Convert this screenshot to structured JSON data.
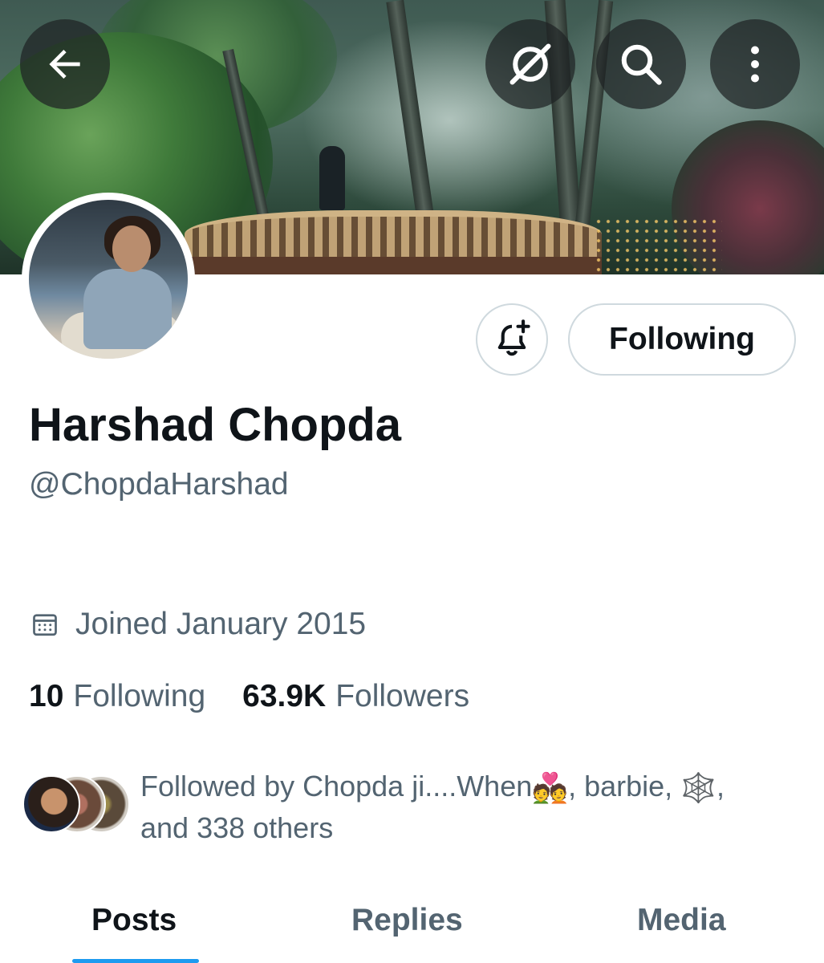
{
  "header": {
    "back_icon": "arrow-left-icon",
    "actions": [
      {
        "name": "grok-icon"
      },
      {
        "name": "search-icon"
      },
      {
        "name": "more-vertical-icon"
      }
    ]
  },
  "profile": {
    "display_name": "Harshad Chopda",
    "handle": "@ChopdaHarshad",
    "joined": "Joined January 2015",
    "joined_icon": "calendar-icon",
    "follow_button_label": "Following",
    "notify_icon": "bell-plus-icon"
  },
  "stats": {
    "following_count": "10",
    "following_label": "Following",
    "followers_count": "63.9K",
    "followers_label": "Followers"
  },
  "followed_by": {
    "prefix": "Followed by Chopda ji....When",
    "emoji_couple": "💑",
    "middle": ", barbie, ",
    "emoji_web": "🕸️",
    "suffix": ",",
    "line2": "and 338 others"
  },
  "tabs": [
    {
      "label": "Posts",
      "active": true
    },
    {
      "label": "Replies",
      "active": false
    },
    {
      "label": "Media",
      "active": false
    }
  ],
  "colors": {
    "accent": "#1d9bf0",
    "text_primary": "#0f1419",
    "text_secondary": "#536471",
    "border": "#cfd9de"
  }
}
